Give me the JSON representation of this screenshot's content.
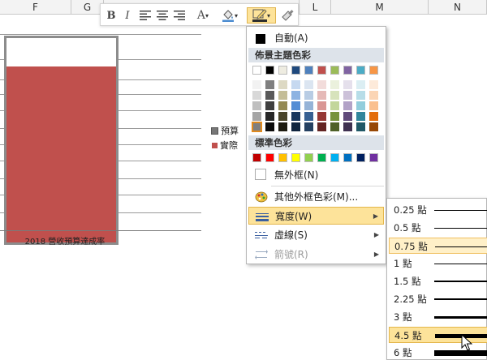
{
  "column_headers": [
    "F",
    "G",
    "L",
    "M",
    "N"
  ],
  "chart": {
    "x_category": "2018 營收預算達成率",
    "legend": [
      {
        "label": "預算",
        "color": "#777777"
      },
      {
        "label": "實際",
        "color": "#c0504d"
      }
    ],
    "bar_fill_color": "#c0504d",
    "bar_outline_color": "#8c8c8c"
  },
  "chart_data": {
    "type": "bar",
    "categories": [
      "2018 營收預算達成率"
    ],
    "series": [
      {
        "name": "預算",
        "values": [
          1.0
        ]
      },
      {
        "name": "實際",
        "values": [
          0.86
        ]
      }
    ]
  },
  "toolbar": {
    "bold": "B",
    "italic": "I",
    "font_color_letter": "A",
    "caret": "▾",
    "icons": [
      "bold-icon",
      "italic-icon",
      "align-left-icon",
      "align-center-icon",
      "align-right-icon",
      "font-color-icon",
      "fill-bucket-icon",
      "outline-pen-icon",
      "format-painter-icon"
    ]
  },
  "color_menu": {
    "automatic": "自動(A)",
    "theme_colors_header": "佈景主題色彩",
    "standard_colors_header": "標準色彩",
    "no_outline": "無外框(N)",
    "more_colors": "其他外框色彩(M)...",
    "weight": "寬度(W)",
    "dashes": "虛線(S)",
    "arrows": "箭號(R)",
    "theme_top": [
      "#ffffff",
      "#000000",
      "#eeece1",
      "#1f497d",
      "#4f81bd",
      "#c0504d",
      "#9bbb59",
      "#8064a2",
      "#4bacc6",
      "#f79646"
    ],
    "theme_shades": [
      [
        "#f2f2f2",
        "#7f7f7f",
        "#ddd9c3",
        "#c6d9f0",
        "#dbe5f1",
        "#f2dcdb",
        "#ebf1dd",
        "#e5e0ec",
        "#dbeef3",
        "#fdeada"
      ],
      [
        "#d8d8d8",
        "#595959",
        "#c4bd97",
        "#8db3e2",
        "#b8cce4",
        "#e5b9b7",
        "#d7e3bc",
        "#ccc1d9",
        "#b7dde8",
        "#fbd5b5"
      ],
      [
        "#bfbfbf",
        "#3f3f3f",
        "#938953",
        "#548dd4",
        "#95b3d7",
        "#d99694",
        "#c3d69b",
        "#b2a2c7",
        "#92cddc",
        "#fac08f"
      ],
      [
        "#a5a5a5",
        "#262626",
        "#494429",
        "#17365d",
        "#366092",
        "#953734",
        "#76923c",
        "#5f497a",
        "#31859b",
        "#e36c09"
      ],
      [
        "#7f7f7f",
        "#0c0c0c",
        "#1d1b10",
        "#0f243e",
        "#244061",
        "#632423",
        "#4f6128",
        "#3f3151",
        "#205867",
        "#974806"
      ]
    ],
    "standard": [
      "#c00000",
      "#ff0000",
      "#ffc000",
      "#ffff00",
      "#92d050",
      "#00b050",
      "#00b0f0",
      "#0070c0",
      "#002060",
      "#7030a0"
    ]
  },
  "weight_menu": {
    "items": [
      {
        "label": "0.25 點",
        "weight": 0.25
      },
      {
        "label": "0.5 點",
        "weight": 0.5
      },
      {
        "label": "0.75 點",
        "weight": 0.75
      },
      {
        "label": "1 點",
        "weight": 1
      },
      {
        "label": "1.5 點",
        "weight": 1.5
      },
      {
        "label": "2.25 點",
        "weight": 2.25
      },
      {
        "label": "3 點",
        "weight": 3
      },
      {
        "label": "4.5 點",
        "weight": 4.5
      },
      {
        "label": "6 點",
        "weight": 6
      }
    ]
  }
}
